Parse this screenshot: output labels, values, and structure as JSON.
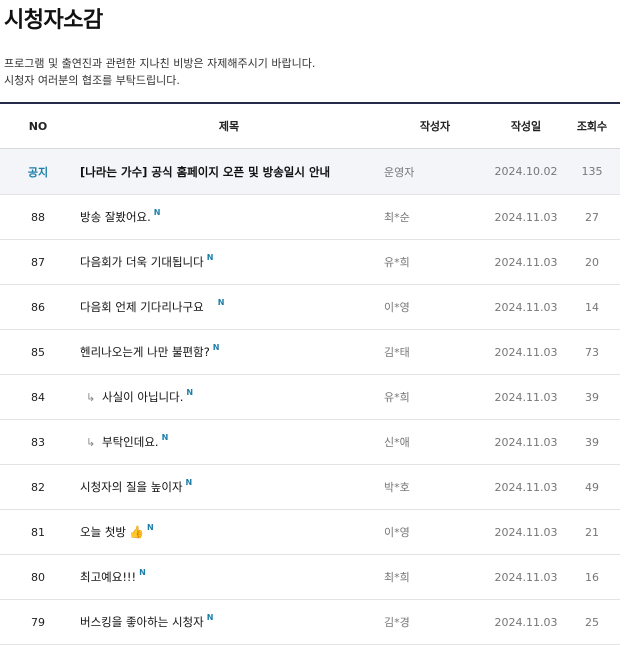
{
  "page": {
    "title": "시청자소감",
    "notice_lines": [
      "프로그램 및 출연진과 관련한 지나친 비방은 자제해주시기 바랍니다.",
      "시청자 여러분의 협조를 부탁드립니다."
    ]
  },
  "table": {
    "headers": {
      "no": "NO",
      "title": "제목",
      "author": "작성자",
      "date": "작성일",
      "views": "조회수"
    },
    "pinned": {
      "no": "공지",
      "title": "[나라는 가수] 공식 홈페이지 오픈 및 방송일시 안내",
      "author": "운영자",
      "date": "2024.10.02",
      "views": "135"
    },
    "new_badge": "N",
    "rows": [
      {
        "no": "88",
        "title": "방송 잘봤어요.",
        "author": "최*순",
        "date": "2024.11.03",
        "views": "27"
      },
      {
        "no": "87",
        "title": "다음회가 더욱 기대됩니다",
        "author": "유*희",
        "date": "2024.11.03",
        "views": "20"
      },
      {
        "no": "86",
        "title": "다음회 언제 기다리나구요",
        "author": "이*영",
        "date": "2024.11.03",
        "views": "14"
      },
      {
        "no": "85",
        "title": "헨리나오는게 나만 불편함?",
        "author": "김*태",
        "date": "2024.11.03",
        "views": "73"
      },
      {
        "no": "84",
        "title": "사실이 아닙니다.",
        "author": "유*희",
        "date": "2024.11.03",
        "views": "39"
      },
      {
        "no": "83",
        "title": "부탁인데요.",
        "author": "신*애",
        "date": "2024.11.03",
        "views": "39"
      },
      {
        "no": "82",
        "title": "시청자의 질을 높이자",
        "author": "박*호",
        "date": "2024.11.03",
        "views": "49"
      },
      {
        "no": "81",
        "title": "오늘 첫방",
        "author": "이*영",
        "date": "2024.11.03",
        "views": "21"
      },
      {
        "no": "80",
        "title": "최고예요!!!",
        "author": "최*희",
        "date": "2024.11.03",
        "views": "16"
      },
      {
        "no": "79",
        "title": "버스킹을 좋아하는 시청자",
        "author": "김*경",
        "date": "2024.11.03",
        "views": "25"
      }
    ]
  },
  "icons": {
    "reply": "reply-arrow-icon",
    "thumbs_up": "thumbs-up-icon"
  },
  "colors": {
    "accent": "#1d7ea8",
    "header_border": "#262a4a",
    "pinned_bg": "#f3f5f8"
  }
}
